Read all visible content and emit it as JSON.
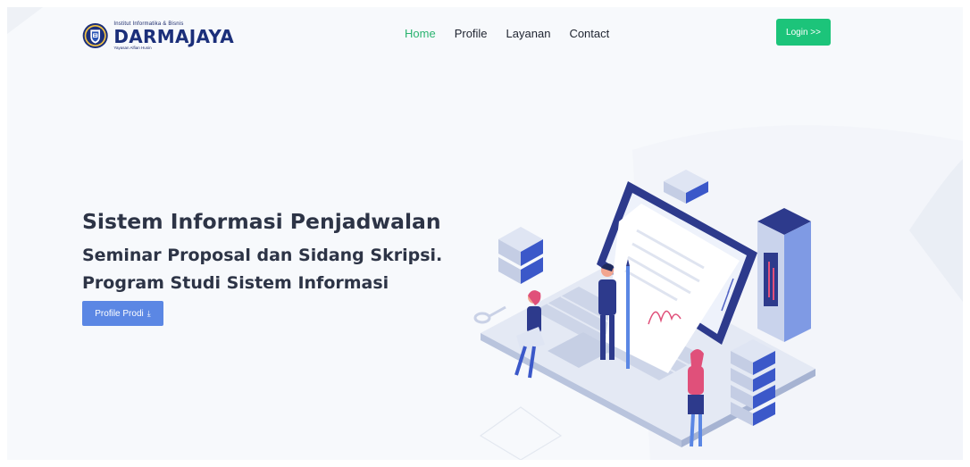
{
  "header": {
    "logo": {
      "institution": "Institut Informatika & Bisnis",
      "name": "DARMAJAYA",
      "foundation": "Yayasan Alfian Husin"
    },
    "nav": [
      {
        "label": "Home",
        "active": true
      },
      {
        "label": "Profile",
        "active": false
      },
      {
        "label": "Layanan",
        "active": false
      },
      {
        "label": "Contact",
        "active": false
      }
    ],
    "login_label": "Login >>"
  },
  "hero": {
    "title": "Sistem Informasi Penjadwalan",
    "line1": "Seminar Proposal dan Sidang Skripsi.",
    "line2": "Program Studi Sistem Informasi",
    "button_label": "Profile Prodi",
    "button_icon": "download-icon"
  },
  "colors": {
    "accent_green": "#1cc47a",
    "active_nav": "#2ab36f",
    "button_blue": "#5b87e4",
    "heading": "#2d3446",
    "logo_navy": "#1b2f7a",
    "background": "#f7f9fc"
  }
}
